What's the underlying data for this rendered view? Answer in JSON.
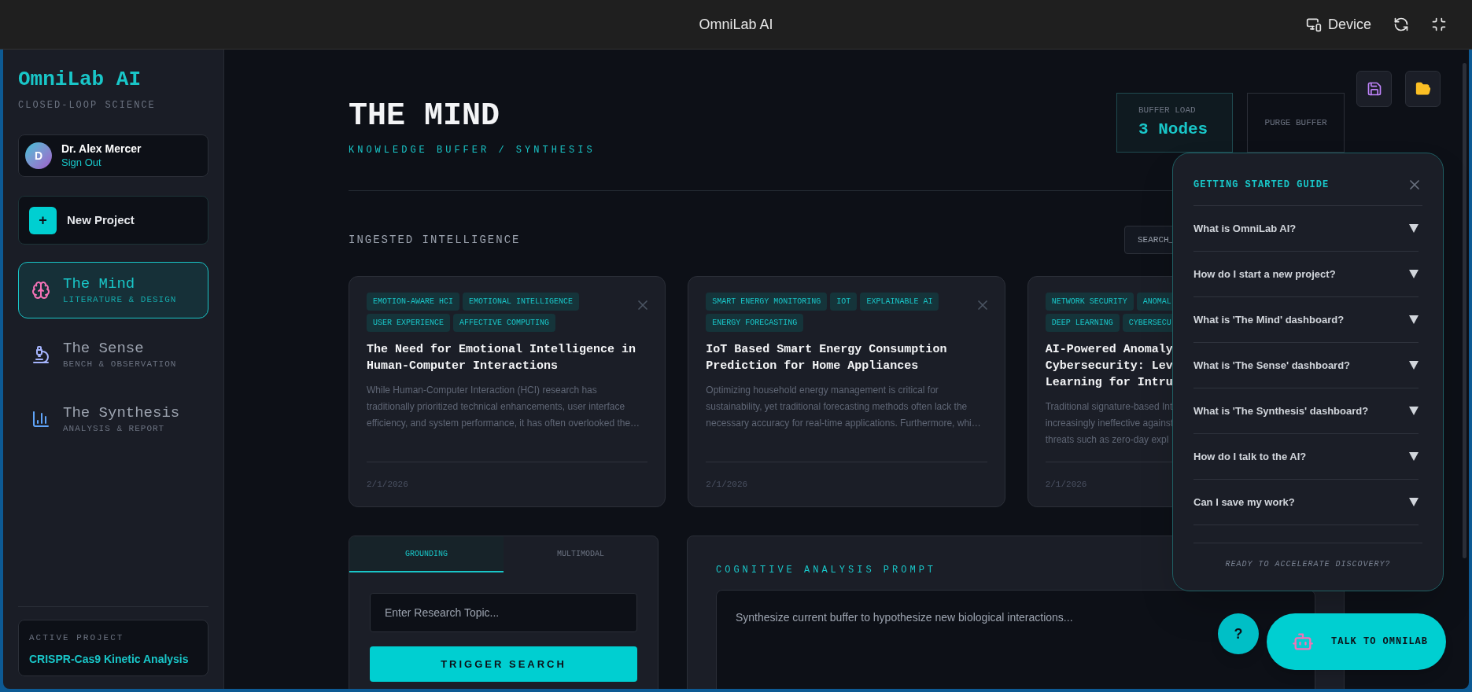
{
  "window": {
    "title": "OmniLab AI",
    "device_label": "Device"
  },
  "sidebar": {
    "brand": "OmniLab AI",
    "tagline": "CLOSED-LOOP SCIENCE",
    "user": {
      "initial": "D",
      "name": "Dr. Alex Mercer",
      "action": "Sign Out"
    },
    "new_project": {
      "icon": "+",
      "label": "New Project"
    },
    "nav": [
      {
        "kind": "brain",
        "label": "The Mind",
        "sublabel": "LITERATURE & DESIGN",
        "selected": true
      },
      {
        "kind": "microscope",
        "label": "The Sense",
        "sublabel": "BENCH & OBSERVATION",
        "selected": false
      },
      {
        "kind": "chart",
        "label": "The Synthesis",
        "sublabel": "ANALYSIS & REPORT",
        "selected": false
      }
    ],
    "active_project": {
      "label": "ACTIVE PROJECT",
      "name": "CRISPR-Cas9 Kinetic Analysis"
    }
  },
  "header": {
    "title": "THE MIND",
    "subtitle": "KNOWLEDGE BUFFER / SYNTHESIS",
    "buffer_label": "BUFFER LOAD",
    "buffer_value": "3 Nodes",
    "purge": "PURGE BUFFER"
  },
  "section": {
    "title": "INGESTED INTELLIGENCE",
    "search_placeholder": "SEARCH_"
  },
  "cards": [
    {
      "tags": [
        [
          "EMOTION-AWARE HCI",
          "EMOTIONAL INTELLIGENCE"
        ],
        [
          "USER EXPERIENCE",
          "AFFECTIVE COMPUTING"
        ]
      ],
      "title_lines": [
        "The Need for Emotional Intelligence in",
        "Human-Computer Interactions"
      ],
      "summary_lines": [
        "While Human-Computer Interaction (HCI) research has",
        "traditionally prioritized technical enhancements, user interface",
        "efficiency, and system performance, it has often overlooked the…"
      ],
      "date": "2/1/2026"
    },
    {
      "tags": [
        [
          "SMART ENERGY MONITORING",
          "IOT",
          "EXPLAINABLE AI"
        ],
        [
          "ENERGY FORECASTING"
        ]
      ],
      "title_lines": [
        "IoT Based Smart Energy Consumption",
        "Prediction for Home Appliances"
      ],
      "summary_lines": [
        "Optimizing household energy management is critical for",
        "sustainability, yet traditional forecasting methods often lack the",
        "necessary accuracy for real-time applications. Furthermore, whi…"
      ],
      "date": "2/1/2026"
    },
    {
      "tags": [
        [
          "NETWORK SECURITY",
          "ANOMAL"
        ],
        [
          "DEEP LEARNING",
          "CYBERSECU"
        ]
      ],
      "title_lines": [
        "AI-Powered Anomaly",
        "Cybersecurity: Lev",
        "Learning for Intru"
      ],
      "summary_lines": [
        "Traditional signature-based Int",
        "increasingly ineffective against",
        "threats such as zero-day expl"
      ],
      "date": "2/1/2026"
    }
  ],
  "search_panel": {
    "tabs": [
      {
        "label": "GROUNDING",
        "selected": true
      },
      {
        "label": "MULTIMODAL",
        "selected": false
      }
    ],
    "placeholder": "Enter Research Topic...",
    "button": "TRIGGER SEARCH"
  },
  "prompt_panel": {
    "title": "COGNITIVE ANALYSIS PROMPT",
    "placeholder": "Synthesize current buffer to hypothesize new biological interactions..."
  },
  "guide": {
    "title": "GETTING STARTED GUIDE",
    "items": [
      {
        "question": "What is OmniLab AI?",
        "expanded": false
      },
      {
        "question": "How do I start a new project?",
        "expanded": false
      },
      {
        "question": "What is 'The Mind' dashboard?",
        "expanded": false
      },
      {
        "question": "What is 'The Sense' dashboard?",
        "expanded": false
      },
      {
        "question": "What is 'The Synthesis' dashboard?",
        "expanded": false
      },
      {
        "question": "How do I talk to the AI?",
        "expanded": false
      },
      {
        "question": "Can I save my work?",
        "expanded": false
      }
    ],
    "footer": "READY TO ACCELERATE DISCOVERY?"
  },
  "help_button": "?",
  "talk_button": "TALK TO OMNILAB"
}
